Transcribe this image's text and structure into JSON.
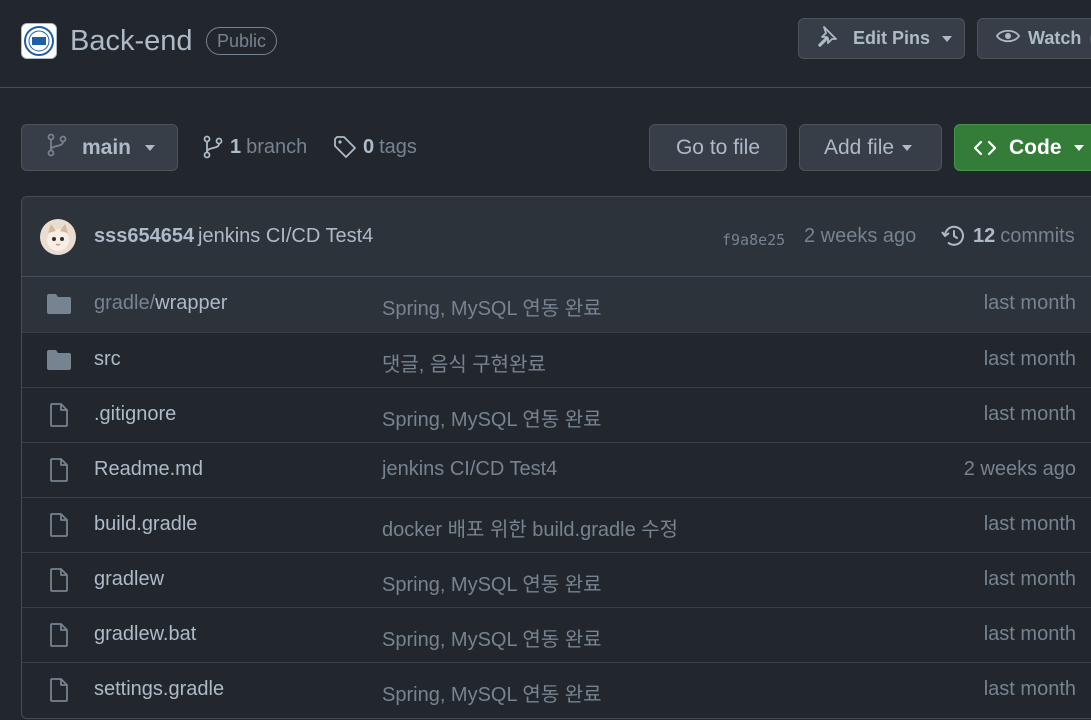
{
  "repo": {
    "name": "Back-end",
    "visibility": "Public"
  },
  "actions": {
    "edit_pins": "Edit Pins",
    "watch": "Watch"
  },
  "toolbar": {
    "branch": "main",
    "branch_count": "1",
    "branch_word": "branch",
    "tag_count": "0",
    "tag_word": "tags",
    "go_to_file": "Go to file",
    "add_file": "Add file",
    "code": "Code"
  },
  "latest_commit": {
    "author": "sss654654",
    "message": "jenkins CI/CD Test4",
    "sha": "f9a8e25",
    "age": "2 weeks ago",
    "commit_count": "12",
    "commit_word": "commits"
  },
  "files": [
    {
      "type": "dir",
      "prefix": "gradle/",
      "name": "wrapper",
      "message": "Spring, MySQL 연동 완료",
      "age": "last month"
    },
    {
      "type": "dir",
      "prefix": "",
      "name": "src",
      "message": "댓글, 음식 구현완료",
      "age": "last month"
    },
    {
      "type": "file",
      "prefix": "",
      "name": ".gitignore",
      "message": "Spring, MySQL 연동 완료",
      "age": "last month"
    },
    {
      "type": "file",
      "prefix": "",
      "name": "Readme.md",
      "message": "jenkins CI/CD Test4",
      "age": "2 weeks ago"
    },
    {
      "type": "file",
      "prefix": "",
      "name": "build.gradle",
      "message": "docker 배포 위한 build.gradle 수정",
      "age": "last month"
    },
    {
      "type": "file",
      "prefix": "",
      "name": "gradlew",
      "message": "Spring, MySQL 연동 완료",
      "age": "last month"
    },
    {
      "type": "file",
      "prefix": "",
      "name": "gradlew.bat",
      "message": "Spring, MySQL 연동 완료",
      "age": "last month"
    },
    {
      "type": "file",
      "prefix": "",
      "name": "settings.gradle",
      "message": "Spring, MySQL 연동 완료",
      "age": "last month"
    }
  ],
  "icons": {
    "org_avatar": "org-logo-icon",
    "pin": "pin-icon",
    "eye": "eye-icon",
    "branch": "git-branch-icon",
    "tag": "tag-icon",
    "code": "code-icon",
    "history": "history-icon",
    "folder": "folder-icon",
    "file": "file-icon"
  },
  "colors": {
    "background": "#22272e",
    "header_bg": "#2d333b",
    "code_button": "#347d39",
    "text": "#adbac7",
    "muted": "#768390"
  }
}
